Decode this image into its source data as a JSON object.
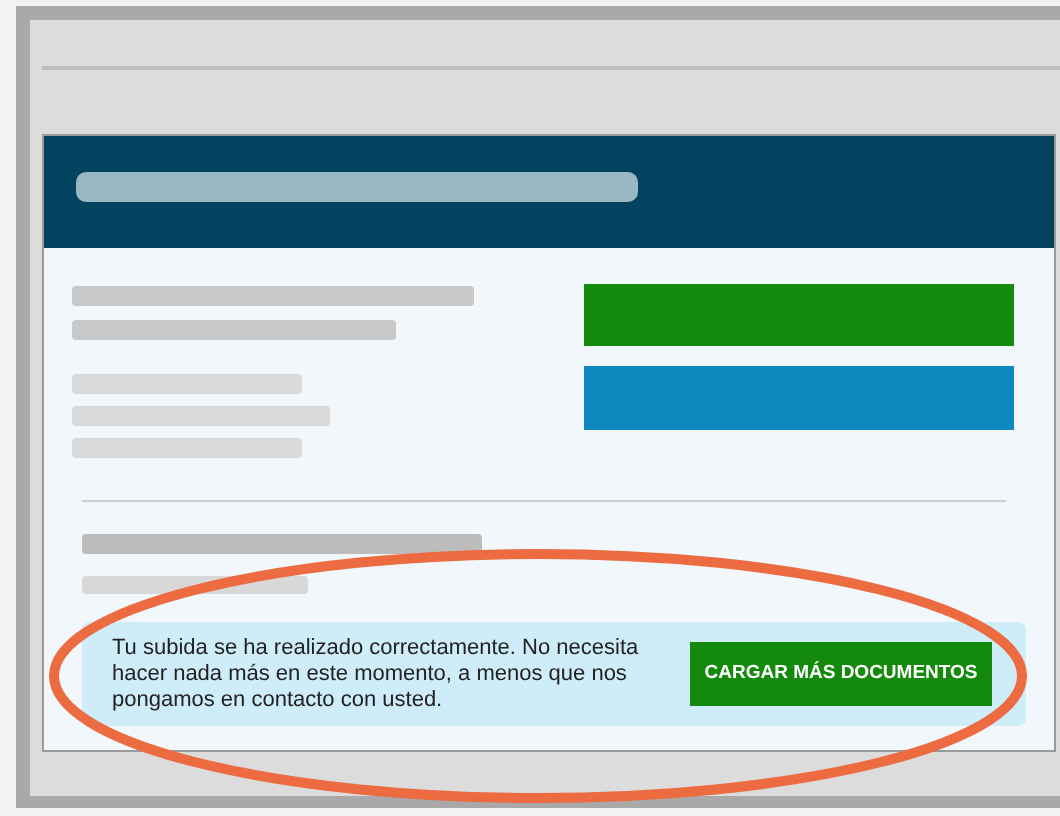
{
  "notice": {
    "message": "Tu subida se ha realizado correctamente. No necesita hacer nada más en este momento, a menos que nos pongamos en contacto con usted.",
    "button": "CARGAR MÁS DOCUMENTOS"
  },
  "annotation": {
    "kind": "ellipse"
  }
}
